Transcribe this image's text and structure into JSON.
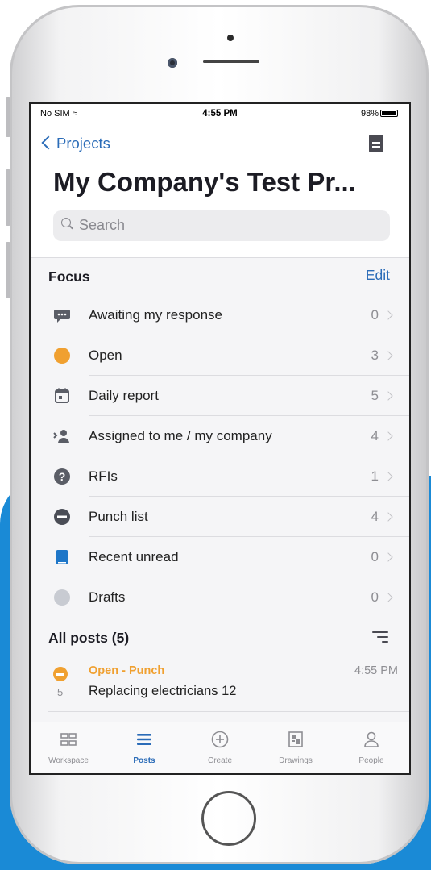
{
  "status_bar": {
    "carrier": "No SIM",
    "time": "4:55 PM",
    "battery": "98%"
  },
  "nav": {
    "back_label": "Projects",
    "doc_icon": "document-icon"
  },
  "project_title": "My Company's Test Pr...",
  "search": {
    "placeholder": "Search"
  },
  "focus": {
    "heading": "Focus",
    "edit_label": "Edit",
    "items": [
      {
        "label": "Awaiting my response",
        "count": "0",
        "icon": "chat-bubble-icon"
      },
      {
        "label": "Open",
        "count": "3",
        "icon": "orange-circle-icon"
      },
      {
        "label": "Daily report",
        "count": "5",
        "icon": "calendar-icon"
      },
      {
        "label": "Assigned to me / my company",
        "count": "4",
        "icon": "assigned-person-icon"
      },
      {
        "label": "RFIs",
        "count": "1",
        "icon": "question-icon"
      },
      {
        "label": "Punch list",
        "count": "4",
        "icon": "minus-circle-icon"
      },
      {
        "label": "Recent unread",
        "count": "0",
        "icon": "book-icon"
      },
      {
        "label": "Drafts",
        "count": "0",
        "icon": "gray-circle-icon"
      }
    ]
  },
  "all_posts": {
    "heading": "All posts (5)",
    "posts": [
      {
        "status": "Open - Punch",
        "time": "4:55 PM",
        "number": "5",
        "title": "Replacing electricians 12"
      }
    ]
  },
  "tabbar": {
    "tabs": [
      {
        "label": "Workspace",
        "icon": "grid-icon"
      },
      {
        "label": "Posts",
        "icon": "list-icon",
        "active": true
      },
      {
        "label": "Create",
        "icon": "plus-circle-icon"
      },
      {
        "label": "Drawings",
        "icon": "drawing-icon"
      },
      {
        "label": "People",
        "icon": "person-icon"
      }
    ]
  },
  "colors": {
    "accent": "#2b6cb8",
    "open_orange": "#f0a030",
    "background_blue": "#1a8ad6"
  }
}
